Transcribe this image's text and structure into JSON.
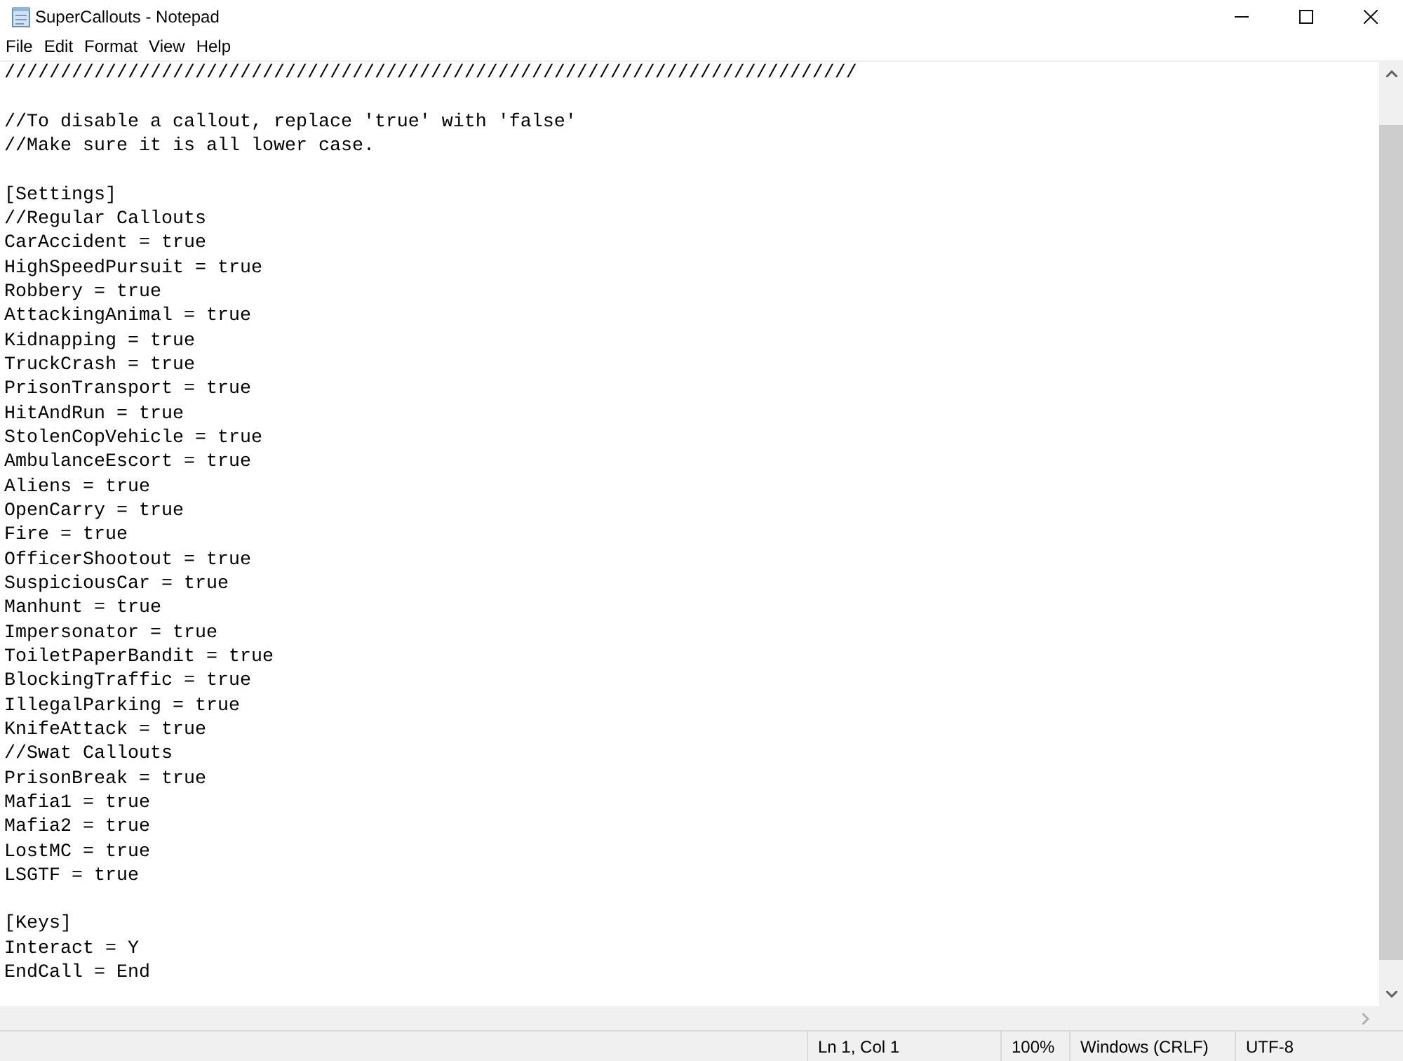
{
  "window": {
    "title": "SuperCallouts - Notepad"
  },
  "menu": [
    "File",
    "Edit",
    "Format",
    "View",
    "Help"
  ],
  "editor": {
    "blocks": [
      [
        "////////////////////////////////////////////////////////////////////////////"
      ],
      [
        "//To disable a callout, replace 'true' with 'false'",
        "//Make sure it is all lower case."
      ],
      [
        "[Settings]",
        "//Regular Callouts",
        "CarAccident = true",
        "HighSpeedPursuit = true",
        "Robbery = true",
        "AttackingAnimal = true",
        "Kidnapping = true",
        "TruckCrash = true",
        "PrisonTransport = true",
        "HitAndRun = true",
        "StolenCopVehicle = true",
        "AmbulanceEscort = true",
        "Aliens = true",
        "OpenCarry = true",
        "Fire = true",
        "OfficerShootout = true",
        "SuspiciousCar = true",
        "Manhunt = true",
        "Impersonator = true",
        "ToiletPaperBandit = true",
        "BlockingTraffic = true",
        "IllegalParking = true",
        "KnifeAttack = true",
        "//Swat Callouts",
        "PrisonBreak = true",
        "Mafia1 = true",
        "Mafia2 = true",
        "LostMC = true",
        "LSGTF = true"
      ],
      [
        "[Keys]",
        "Interact = Y",
        "EndCall = End"
      ]
    ]
  },
  "status_bar": [
    "Ln 1, Col 1",
    "100%",
    "Windows (CRLF)",
    "UTF-8"
  ]
}
